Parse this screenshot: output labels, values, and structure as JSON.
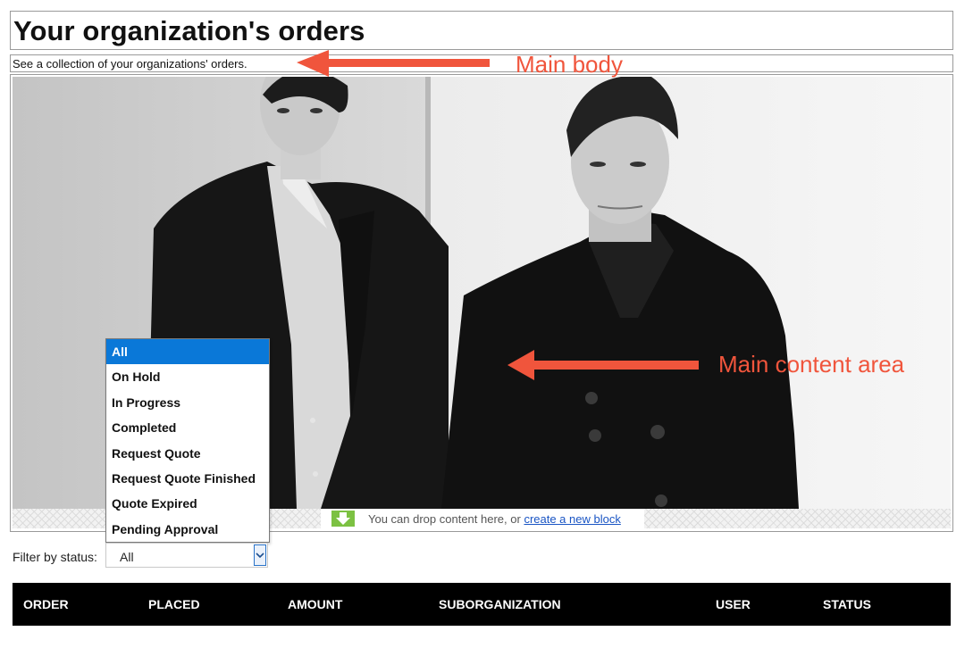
{
  "page": {
    "title": "Your organization's orders",
    "subtitle": "See a collection of your organizations' orders."
  },
  "annotations": {
    "main_body": "Main body",
    "main_content_area": "Main content area",
    "color": "#f0553c"
  },
  "drop_zone": {
    "message": "You can drop content here, or ",
    "link_text": "create a new block",
    "icon": "arrow-down-icon"
  },
  "filter": {
    "label": "Filter by status:",
    "selected": "All",
    "options": [
      "All",
      "On Hold",
      "In Progress",
      "Completed",
      "Request Quote",
      "Request Quote Finished",
      "Quote Expired",
      "Pending Approval"
    ],
    "highlight_color": "#0a78d8"
  },
  "table": {
    "columns": [
      "ORDER",
      "PLACED",
      "AMOUNT",
      "SUBORGANIZATION",
      "USER",
      "STATUS"
    ]
  }
}
